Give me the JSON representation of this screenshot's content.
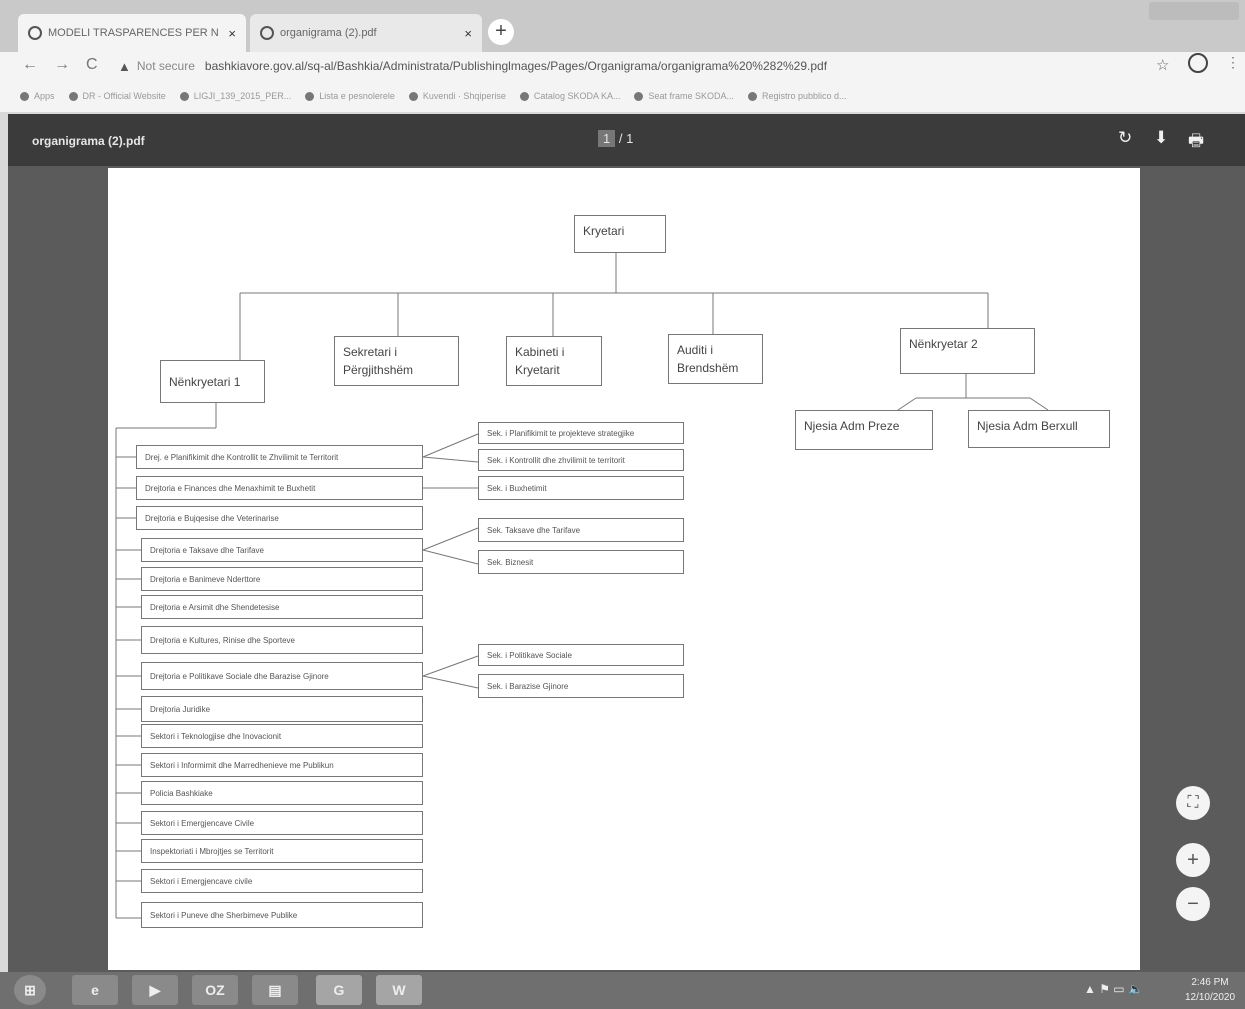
{
  "browser": {
    "tabs": [
      {
        "title": "MODELI TRASPARENCES PER N",
        "active": true
      },
      {
        "title": "organigrama (2).pdf",
        "active": false
      }
    ],
    "new_tab_label": "+",
    "close_glyph": "×",
    "nav": {
      "back": "←",
      "forward": "→",
      "reload": "C"
    },
    "security_label": "Not secure",
    "url": "bashkiavore.gov.al/sq-al/Bashkia/Administrata/Publishinglmages/Pages/Organigrama/organigrama%20%282%29.pdf",
    "star_icon": "☆",
    "menu_icon": "⋮",
    "bookmarks": [
      "Apps",
      "DR - Official Website",
      "LIGJI_139_2015_PER...",
      "Lista e pesnolerele",
      "Kuvendi · Shqiperise",
      "Catalog SKODA KA...",
      "Seat frame SKODA...",
      "Registro pubblico d..."
    ]
  },
  "pdf": {
    "title": "organigrama (2).pdf",
    "page_current": "1",
    "page_sep": "/",
    "page_total": "1",
    "icons": {
      "rotate": "↻",
      "download": "⬇",
      "print": "🖶"
    }
  },
  "org": {
    "top": "Kryetari",
    "level2": [
      "Nënkryetari 1",
      "Sekretari i Përgjithshëm",
      "Kabineti i Kryetarit",
      "Auditi i Brendshëm",
      "Nënkryetar 2"
    ],
    "units": [
      "Njesia Adm Preze",
      "Njesia Adm Berxull"
    ],
    "departments": [
      "Drej. e Planifikimit dhe Kontrollit te Zhvilimit te Territorit",
      "Drejtoria e Finances dhe Menaxhimit te Buxhetit",
      "Drejtoria e Bujqesise dhe Veterinarise",
      "Drejtoria e Taksave dhe Tarifave",
      "Drejtoria e Banimeve Nderttore",
      "Drejtoria e Arsimit dhe Shendetesise",
      "Drejtoria e Kultures, Rinise dhe Sporteve",
      "Drejtoria e Politikave Sociale dhe Barazise Gjinore",
      "Drejtoria Juridike",
      "Sektori i Teknologjise dhe Inovacionit",
      "Sektori i Informimit dhe Marredhenieve me Publikun",
      "Policia Bashkiake",
      "Sektori i Emergjencave Civile",
      "Inspektoriati i Mbrojtjes se Territorit",
      "Sektori i Emergjencave civile",
      "Sektori i Puneve dhe Sherbimeve Publike"
    ],
    "sections": [
      "Sek. i Planifikimit te projekteve strategjike",
      "Sek. i Kontrollit dhe zhvilimit te territorit",
      "Sek. i Buxhetimit",
      "Sek. Taksave dhe Tarifave",
      "Sek. Biznesit",
      "Sek. i Politikave Sociale",
      "Sek. i Barazise Gjinore"
    ]
  },
  "zoom_controls": {
    "fit": "⛶",
    "plus": "+",
    "minus": "−"
  },
  "taskbar": {
    "apps": [
      "⊞",
      "e",
      "▶",
      "OZ",
      "▤",
      "G",
      "W"
    ],
    "tray": "▲ ⚑ ▭ 🔈",
    "time": "2:46 PM",
    "date": "12/10/2020"
  }
}
